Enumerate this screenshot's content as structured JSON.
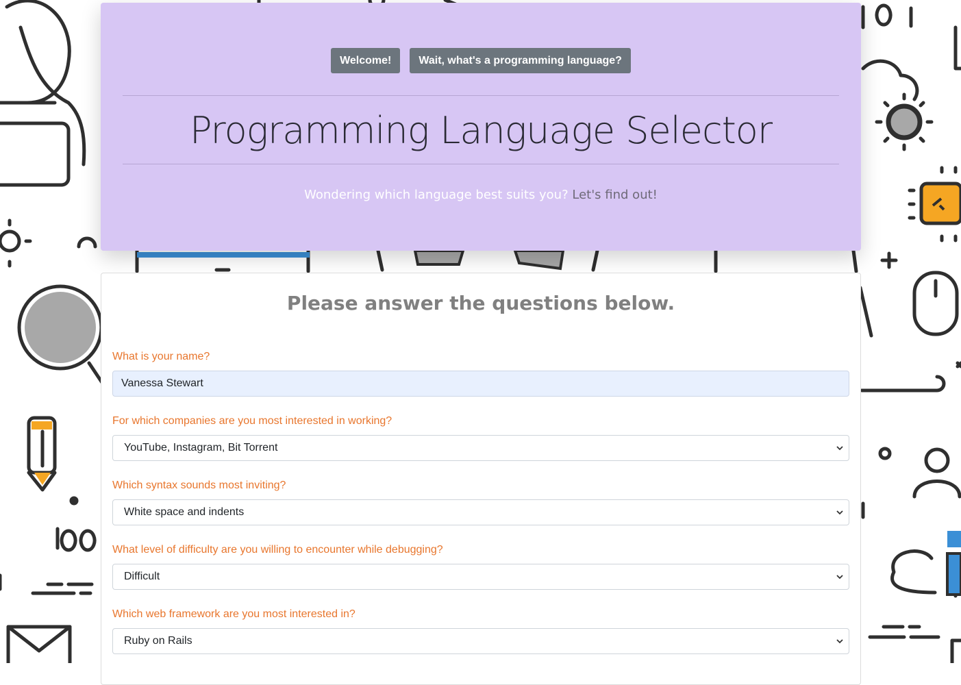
{
  "nav_buttons": {
    "welcome": "Welcome!",
    "what_is": "Wait, what's a programming language?"
  },
  "header": {
    "title": "Programming Language Selector",
    "lead_text": "Wondering which language best suits you?",
    "lead_accent": "Let's find out!"
  },
  "form": {
    "heading": "Please answer the questions below.",
    "questions": [
      {
        "label": "What is your name?",
        "type": "text",
        "value": "Vanessa Stewart"
      },
      {
        "label": "For which companies are you most interested in working?",
        "type": "select",
        "value": "YouTube, Instagram, Bit Torrent"
      },
      {
        "label": "Which syntax sounds most inviting?",
        "type": "select",
        "value": "White space and indents"
      },
      {
        "label": "What level of difficulty are you willing to encounter while debugging?",
        "type": "select",
        "value": "Difficult"
      },
      {
        "label": "Which web framework are you most interested in?",
        "type": "select",
        "value": "Ruby on Rails"
      }
    ]
  },
  "colors": {
    "jumbotron_bg": "#d7c6f4",
    "button_bg": "#6c757d",
    "question_label": "#e8762d",
    "autofill_bg": "#e8f0fe"
  }
}
